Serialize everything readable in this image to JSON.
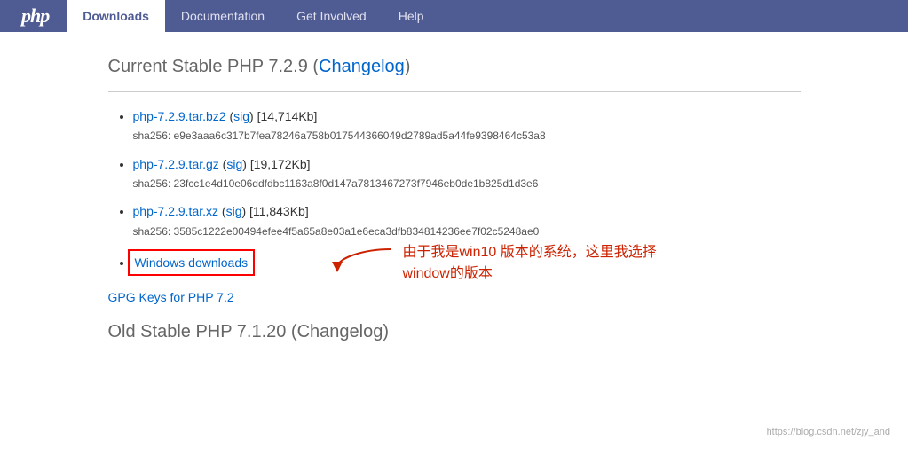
{
  "nav": {
    "logo": "php",
    "items": [
      {
        "label": "Downloads",
        "active": true
      },
      {
        "label": "Documentation",
        "active": false
      },
      {
        "label": "Get Involved",
        "active": false
      },
      {
        "label": "Help",
        "active": false
      }
    ]
  },
  "main": {
    "current_section_title": "Current Stable PHP 7.2.9 (",
    "changelog_label": "Changelog",
    "changelog_suffix": ")",
    "downloads": [
      {
        "filename": "php-7.2.9.tar.bz2",
        "sig_label": "sig",
        "size": "[14,714Kb]",
        "hash_label": "sha256:",
        "hash": "e9e3aaa6c317b7fea78246a758b017544366049d2789ad5a44fe9398464c53a8"
      },
      {
        "filename": "php-7.2.9.tar.gz",
        "sig_label": "sig",
        "size": "[19,172Kb]",
        "hash_label": "sha256:",
        "hash": "23fcc1e4d10e06ddfdbc1163a8f0d147a7813467273f7946eb0de1b825d1d3e6"
      },
      {
        "filename": "php-7.2.9.tar.xz",
        "sig_label": "sig",
        "size": "[11,843Kb]",
        "hash_label": "sha256:",
        "hash": "3585c1222e00494efee4f5a65a8e03a1e6eca3dfb834814236ee7f02c5248ae0"
      }
    ],
    "windows_label": "Windows downloads",
    "annotation_text_line1": "由于我是win10 版本的系统，这里我选择",
    "annotation_text_line2": "window的版本",
    "gpg_label": "GPG Keys for PHP 7.2",
    "old_section_title": "Old Stable PHP 7.1.20 (",
    "old_changelog_label": "Changelog",
    "old_section_suffix": ")"
  },
  "watermark": "https://blog.csdn.net/zjy_and"
}
